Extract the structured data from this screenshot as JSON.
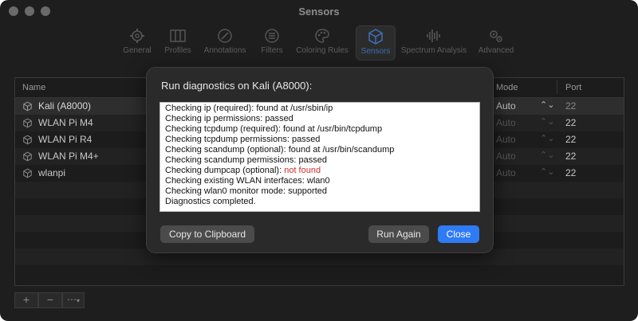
{
  "window": {
    "title": "Sensors"
  },
  "toolbar": {
    "items": [
      {
        "label": "General",
        "icon": "gear-icon"
      },
      {
        "label": "Profiles",
        "icon": "columns-icon"
      },
      {
        "label": "Annotations",
        "icon": "pencil-circle-icon"
      },
      {
        "label": "Filters",
        "icon": "filter-list-icon"
      },
      {
        "label": "Coloring Rules",
        "icon": "palette-icon"
      },
      {
        "label": "Sensors",
        "icon": "cube-icon",
        "active": true
      },
      {
        "label": "Spectrum Analysis",
        "icon": "waveform-icon"
      },
      {
        "label": "Advanced",
        "icon": "gears-icon"
      }
    ]
  },
  "table": {
    "columns": {
      "name": "Name",
      "mode": "Mode",
      "port": "Port"
    },
    "rows": [
      {
        "name": "Kali (A8000)",
        "mode": "Auto",
        "port": "22"
      },
      {
        "name": "WLAN Pi M4",
        "mode": "Auto",
        "port": "22"
      },
      {
        "name": "WLAN Pi R4",
        "mode": "Auto",
        "port": "22"
      },
      {
        "name": "WLAN Pi M4+",
        "mode": "Auto",
        "port": "22"
      },
      {
        "name": "wlanpi",
        "mode": "Auto",
        "port": "22"
      }
    ]
  },
  "bottom": {
    "add": "+",
    "remove": "−",
    "more": "⋯"
  },
  "dialog": {
    "title": "Run diagnostics on Kali (A8000):",
    "log": [
      {
        "text": "Checking ip (required): found at /usr/sbin/ip"
      },
      {
        "text": "Checking ip permissions: passed"
      },
      {
        "text": "Checking tcpdump (required): found at /usr/bin/tcpdump"
      },
      {
        "text": "Checking tcpdump permissions: passed"
      },
      {
        "text": "Checking scandump (optional): found at /usr/bin/scandump"
      },
      {
        "text": "Checking scandump permissions: passed"
      },
      {
        "text": "Checking dumpcap (optional): ",
        "error": "not found"
      },
      {
        "text": "Checking existing WLAN interfaces: wlan0"
      },
      {
        "text": "Checking wlan0 monitor mode: supported"
      },
      {
        "text": "Diagnostics completed."
      }
    ],
    "copy_label": "Copy to Clipboard",
    "run_again_label": "Run Again",
    "close_label": "Close"
  },
  "colors": {
    "accent": "#2f7bf5",
    "error": "#d0302a"
  }
}
